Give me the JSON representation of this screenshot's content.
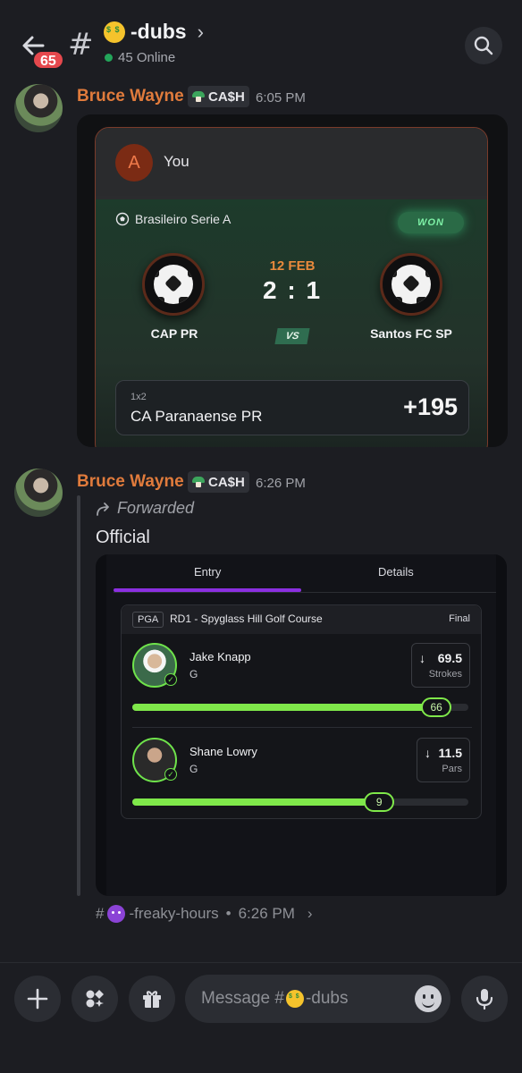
{
  "header": {
    "unread_count": "65",
    "hash": "#",
    "channel_name": "-dubs",
    "online_text": "45 Online"
  },
  "messages": [
    {
      "author": "Bruce Wayne",
      "tag": "CA$H",
      "time": "6:05 PM",
      "bet_card": {
        "user_initial": "A",
        "user_name": "You",
        "league": "Brasileiro Serie A",
        "status": "WON",
        "date": "12 FEB",
        "score": "2 : 1",
        "home_team": "CAP PR",
        "away_team": "Santos FC SP",
        "vs": "VS",
        "pick_type": "1x2",
        "pick_name": "CA Paranaense PR",
        "odds": "+195"
      }
    },
    {
      "author": "Bruce Wayne",
      "tag": "CA$H",
      "time": "6:26 PM",
      "forwarded_label": "Forwarded",
      "text": "Official",
      "entry_card": {
        "tabs": [
          "Entry",
          "Details"
        ],
        "league_pill": "PGA",
        "event": "RD1 - Spyglass Hill Golf Course",
        "status": "Final",
        "players": [
          {
            "name": "Jake Knapp",
            "position": "G",
            "line": "69.5",
            "stat": "Strokes",
            "actual": "66",
            "progress": 0.95
          },
          {
            "name": "Shane Lowry",
            "position": "G",
            "line": "11.5",
            "stat": "Pars",
            "actual": "9",
            "progress": 0.78
          }
        ]
      },
      "thread": {
        "hash": "#",
        "name": "-freaky-hours",
        "sep": "•",
        "time": "6:26 PM"
      }
    }
  ],
  "composer": {
    "placeholder_prefix": "Message #",
    "placeholder_channel": "-dubs"
  },
  "icons": [
    "back-arrow-icon",
    "search-icon",
    "chevron-right-icon",
    "plus-icon",
    "apps-icon",
    "gift-icon",
    "emoji-icon",
    "microphone-icon",
    "forward-icon",
    "soccer-icon",
    "arrow-down-icon",
    "check-icon"
  ],
  "colors": {
    "author": "#e07b3c",
    "online": "#23a55a",
    "badge": "#e5484d",
    "progress": "#7fe84a",
    "tab_active": "#8b2fe0"
  }
}
